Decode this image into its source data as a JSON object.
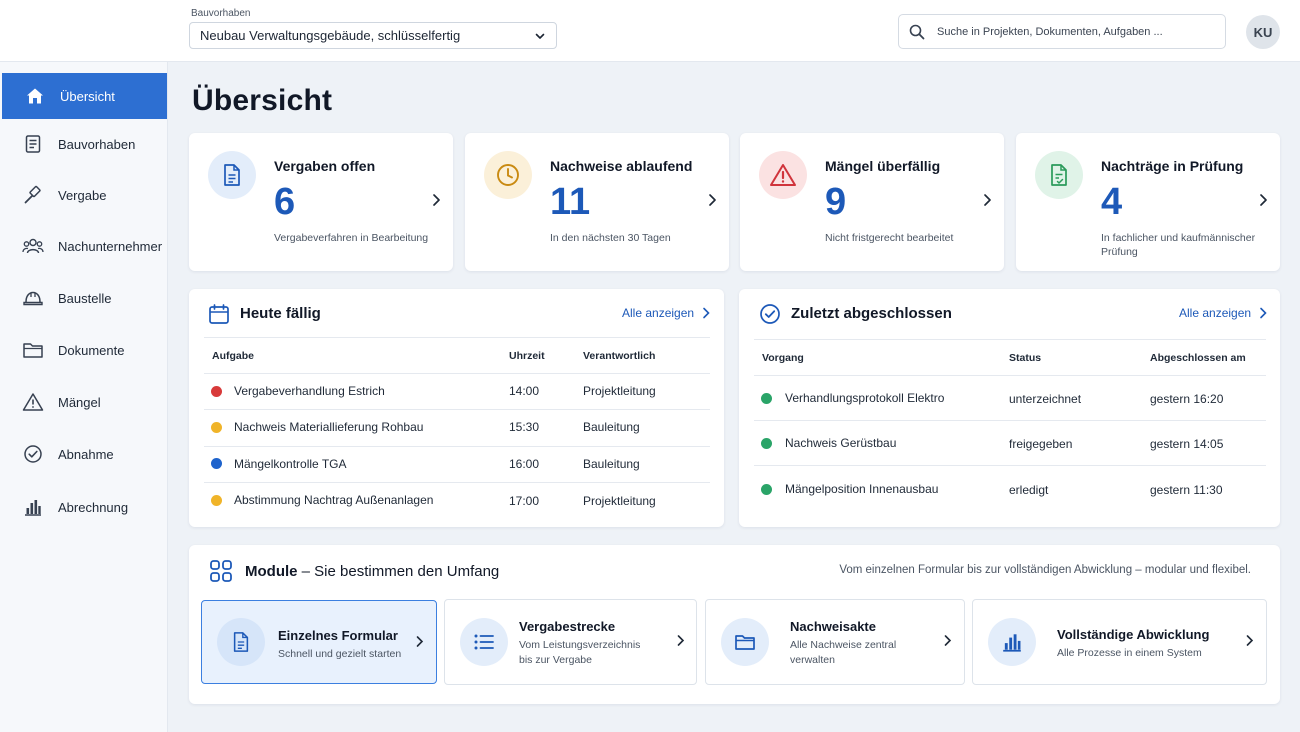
{
  "header": {
    "project_label": "Bauvorhaben",
    "project_value": "Neubau Verwaltungsgebäude, schlüsselfertig",
    "search_placeholder": "Suche in Projekten, Dokumenten, Aufgaben ...",
    "avatar_initials": "KU"
  },
  "sidebar": {
    "items": [
      {
        "label": "Übersicht",
        "icon": "home-icon",
        "active": true
      },
      {
        "label": "Bauvorhaben",
        "icon": "document-list-icon"
      },
      {
        "label": "Vergabe",
        "icon": "gavel-icon"
      },
      {
        "label": "Nachunternehmer",
        "icon": "users-icon"
      },
      {
        "label": "Baustelle",
        "icon": "hard-hat-icon"
      },
      {
        "label": "Dokumente",
        "icon": "folder-icon"
      },
      {
        "label": "Mängel",
        "icon": "warning-icon"
      },
      {
        "label": "Abnahme",
        "icon": "check-circle-icon"
      },
      {
        "label": "Abrechnung",
        "icon": "bar-chart-icon"
      }
    ]
  },
  "page": {
    "title": "Übersicht"
  },
  "kpis": [
    {
      "title": "Vergaben offen",
      "value": "6",
      "subtitle": "Vergabeverfahren in Bearbeitung",
      "icon": "document-icon",
      "color": "#1d59b8",
      "bg": "#e3edfa"
    },
    {
      "title": "Nachweise ablaufend",
      "value": "11",
      "subtitle": "In den nächsten 30 Tagen",
      "icon": "clock-icon",
      "color": "#c98a12",
      "bg": "#fbf0d9"
    },
    {
      "title": "Mängel überfällig",
      "value": "9",
      "subtitle": "Nicht fristgerecht bearbeitet",
      "icon": "warning-icon",
      "color": "#d0343c",
      "bg": "#fbe2e2"
    },
    {
      "title": "Nachträge in Prüfung",
      "value": "4",
      "subtitle": "In fachlicher und kaufmännischer Prüfung",
      "icon": "document-check-icon",
      "color": "#2a9a5a",
      "bg": "#e0f3e8"
    }
  ],
  "today": {
    "title": "Heute fällig",
    "link": "Alle anzeigen",
    "columns": [
      "Aufgabe",
      "Uhrzeit",
      "Verantwortlich"
    ],
    "rows": [
      {
        "task": "Vergabeverhandlung Estrich",
        "time": "14:00",
        "owner": "Projektleitung",
        "color": "#d83a3a"
      },
      {
        "task": "Nachweis Materiallieferung Rohbau",
        "time": "15:30",
        "owner": "Bauleitung",
        "color": "#f0b429"
      },
      {
        "task": "Mängelkontrolle TGA",
        "time": "16:00",
        "owner": "Bauleitung",
        "color": "#1e63cc"
      },
      {
        "task": "Abstimmung Nachtrag Außenanlagen",
        "time": "17:00",
        "owner": "Projektleitung",
        "color": "#f0b429"
      }
    ]
  },
  "done": {
    "title": "Zuletzt abgeschlossen",
    "link": "Alle anzeigen",
    "columns": [
      "Vorgang",
      "Status",
      "Abgeschlossen am"
    ],
    "rows": [
      {
        "item": "Verhandlungsprotokoll Elektro",
        "status": "unterzeichnet",
        "date": "gestern 16:20",
        "color": "#2aa468"
      },
      {
        "item": "Nachweis Gerüstbau",
        "status": "freigegeben",
        "date": "gestern 14:05",
        "color": "#2aa468"
      },
      {
        "item": "Mängelposition Innenausbau",
        "status": "erledigt",
        "date": "gestern 11:30",
        "color": "#2aa468"
      }
    ]
  },
  "modules": {
    "title_bold": "Module",
    "title_rest": " – Sie bestimmen den Umfang",
    "tagline": "Vom einzelnen Formular bis zur vollständigen Abwicklung – modular und flexibel.",
    "items": [
      {
        "title": "Einzelnes Formular",
        "subtitle": "Schnell und gezielt starten",
        "icon": "document-icon",
        "selected": true
      },
      {
        "title": "Vergabestrecke",
        "subtitle": "Vom Leistungsverzeichnis bis zur Vergabe",
        "icon": "list-icon"
      },
      {
        "title": "Nachweisakte",
        "subtitle": "Alle Nachweise zentral verwalten",
        "icon": "folder-icon"
      },
      {
        "title": "Vollständige Abwicklung",
        "subtitle": "Alle Prozesse in einem System",
        "icon": "bar-chart-icon"
      }
    ]
  }
}
